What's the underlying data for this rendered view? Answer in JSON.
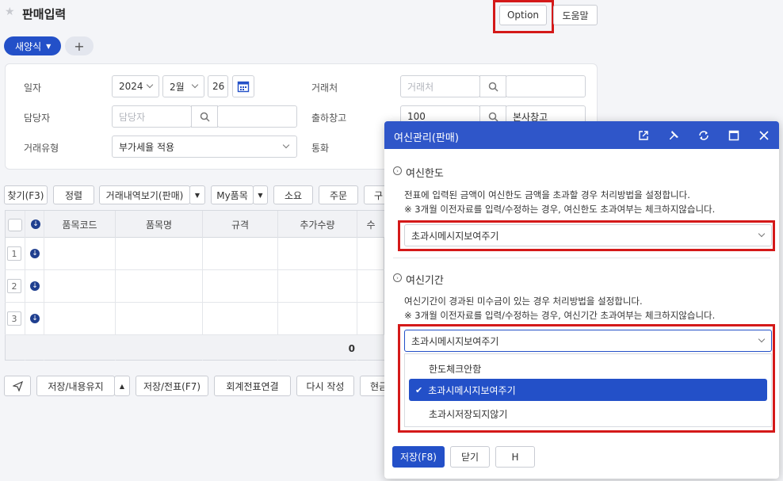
{
  "page": {
    "title": "판매입력",
    "option_label": "Option",
    "help_label": "도움말",
    "new_form_tab": "새양식",
    "add_tab": "+"
  },
  "form": {
    "date_label": "일자",
    "year": "2024",
    "month": "2월",
    "day": "26",
    "client_label": "거래처",
    "client_placeholder": "거래처",
    "manager_label": "담당자",
    "manager_placeholder": "담당자",
    "warehouse_label": "출하창고",
    "warehouse_code": "100",
    "warehouse_name": "본사창고",
    "trade_type_label": "거래유형",
    "trade_type_value": "부가세율 적용",
    "currency_label": "통화"
  },
  "toolbar": {
    "find": "찾기(F3)",
    "sort": "정렬",
    "history": "거래내역보기(판매)",
    "my_items": "My품목",
    "consume": "소요",
    "order": "주문",
    "cut": "구"
  },
  "table": {
    "headers": [
      "품목코드",
      "품목명",
      "규격",
      "추가수량",
      "수"
    ],
    "rows": [
      "1",
      "2",
      "3"
    ],
    "total": "0"
  },
  "bottom": {
    "keep_save": "저장/내용유지",
    "save_slip": "저장/전표(F7)",
    "link_slip": "회계전표연결",
    "rewrite": "다시 작성",
    "current": "현금"
  },
  "modal": {
    "title": "여신관리(판매)",
    "section1_title": "여신한도",
    "section1_desc": "전표에 입력된 금액이 여신한도 금액을 초과할 경우 처리방법을 설정합니다.",
    "section1_note": "※ 3개월 이전자료를 입력/수정하는 경우, 여신한도 초과여부는 체크하지않습니다.",
    "section1_value": "초과시메시지보여주기",
    "section2_title": "여신기간",
    "section2_desc": "여신기간이 경과된 미수금이 있는 경우 처리방법을 설정합니다.",
    "section2_note": "※ 3개월 이전자료를 입력/수정하는 경우, 여신기간 초과여부는 체크하지않습니다.",
    "section2_value": "초과시메시지보여주기",
    "options": [
      "한도체크안함",
      "초과시메시지보여주기",
      "초과시저장되지않기"
    ],
    "save_label": "저장(F8)",
    "close_label": "닫기",
    "h_label": "H"
  },
  "colors": {
    "primary": "#2350c8",
    "modal_header": "#2f56c9",
    "highlight": "#d41919"
  }
}
